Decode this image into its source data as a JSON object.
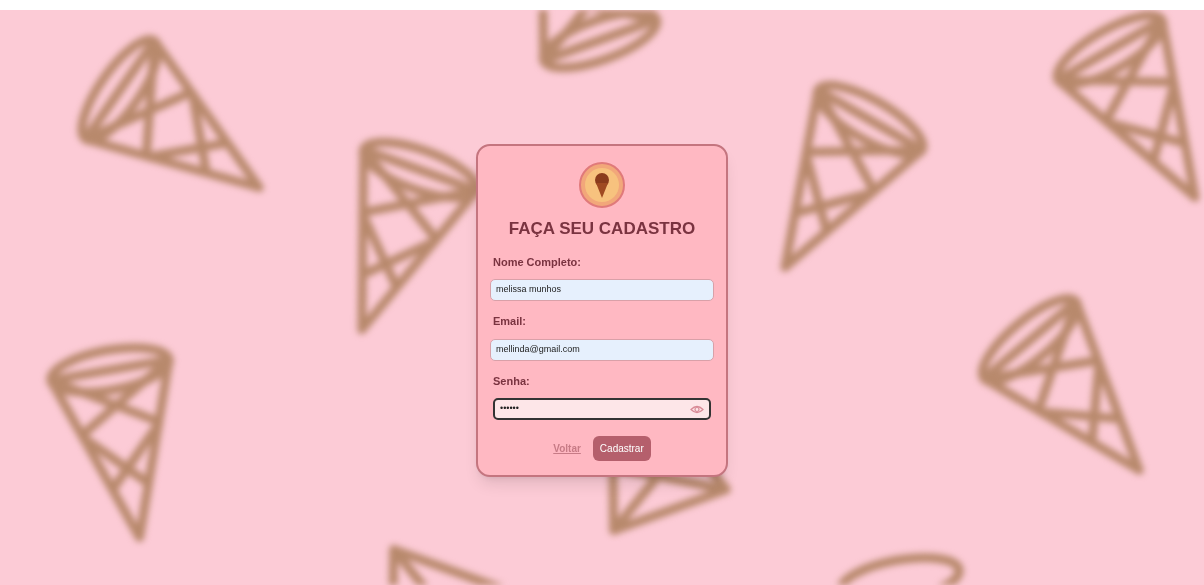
{
  "form": {
    "title": "FAÇA SEU CADASTRO",
    "fields": [
      {
        "kind": "text",
        "label": "Nome Completo:",
        "value": "melissa munhos",
        "focused": false
      },
      {
        "kind": "text",
        "label": "Email:",
        "value": "mellinda@gmail.com",
        "focused": false
      },
      {
        "kind": "password",
        "label": "Senha:",
        "value": "••••••",
        "focused": true
      }
    ],
    "back_link": "Voltar",
    "submit_button": "Cadastrar"
  }
}
